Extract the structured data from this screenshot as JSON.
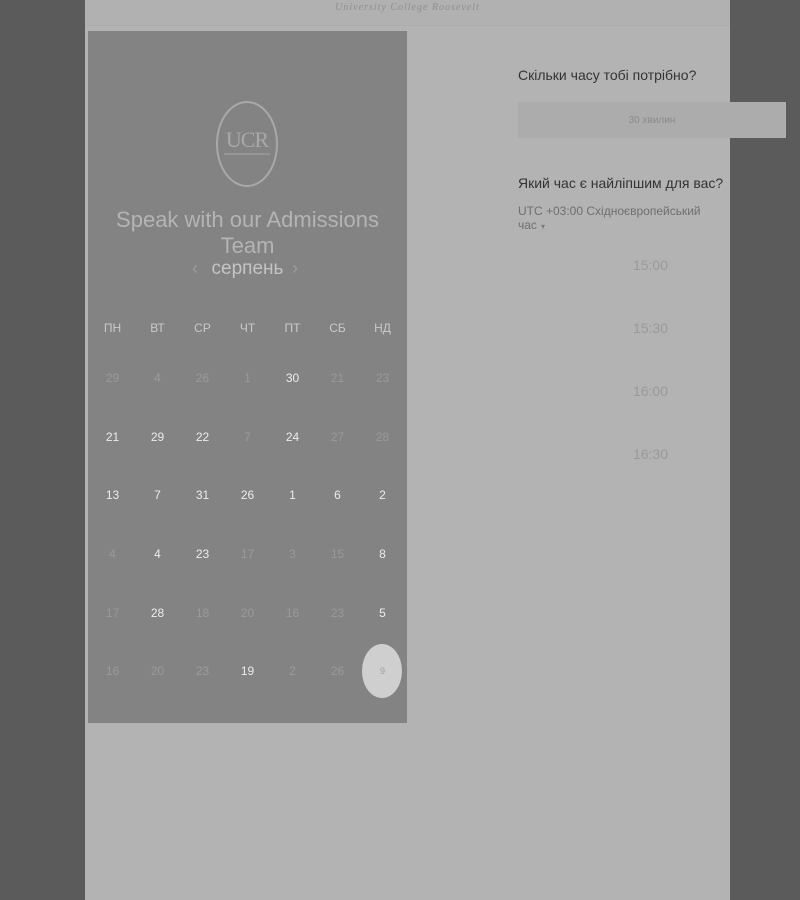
{
  "header": {
    "brand_line": "University College Roosevelt"
  },
  "calendar": {
    "logo_text": "UCR",
    "title": "Speak with our Admissions Team",
    "prev_arrow": "‹",
    "next_arrow": "›",
    "month": "серпень",
    "weekdays": [
      "ПН",
      "ВТ",
      "СР",
      "ЧТ",
      "ПТ",
      "СБ",
      "НД"
    ],
    "days": [
      {
        "label": "29",
        "available": false
      },
      {
        "label": "4",
        "available": false
      },
      {
        "label": "26",
        "available": false
      },
      {
        "label": "1",
        "available": false
      },
      {
        "label": "30",
        "available": true
      },
      {
        "label": "21",
        "available": false
      },
      {
        "label": "23",
        "available": false
      },
      {
        "label": "21",
        "available": true
      },
      {
        "label": "29",
        "available": true
      },
      {
        "label": "22",
        "available": true
      },
      {
        "label": "7",
        "available": false
      },
      {
        "label": "24",
        "available": true
      },
      {
        "label": "27",
        "available": false
      },
      {
        "label": "28",
        "available": false
      },
      {
        "label": "13",
        "available": true
      },
      {
        "label": "7",
        "available": true
      },
      {
        "label": "31",
        "available": true
      },
      {
        "label": "26",
        "available": true
      },
      {
        "label": "1",
        "available": true
      },
      {
        "label": "6",
        "available": true
      },
      {
        "label": "2",
        "available": true
      },
      {
        "label": "4",
        "available": false
      },
      {
        "label": "4",
        "available": true
      },
      {
        "label": "23",
        "available": true
      },
      {
        "label": "17",
        "available": false
      },
      {
        "label": "3",
        "available": false
      },
      {
        "label": "15",
        "available": false
      },
      {
        "label": "8",
        "available": true
      },
      {
        "label": "17",
        "available": false
      },
      {
        "label": "28",
        "available": true
      },
      {
        "label": "18",
        "available": false
      },
      {
        "label": "20",
        "available": false
      },
      {
        "label": "16",
        "available": false
      },
      {
        "label": "23",
        "available": false
      },
      {
        "label": "5",
        "available": true
      },
      {
        "label": "16",
        "available": false
      },
      {
        "label": "20",
        "available": false
      },
      {
        "label": "23",
        "available": false
      },
      {
        "label": "19",
        "available": true
      },
      {
        "label": "2",
        "available": false
      },
      {
        "label": "26",
        "available": false
      },
      {
        "label": "9",
        "available": true,
        "selected": true
      }
    ]
  },
  "booking": {
    "duration_question": "Скільки часу тобі потрібно?",
    "duration_value": "30 хвилин",
    "time_question": "Який час є найліпшим для вас?",
    "timezone": "UTC +03:00 Східноєвропейський час",
    "slots": [
      "15:00",
      "15:30",
      "16:00",
      "16:30"
    ]
  },
  "colors": {
    "backdrop": "#5b5b5b",
    "page": "#b3b3b3",
    "calendar_panel": "#838383",
    "selected_day": "#cfcfcf"
  }
}
